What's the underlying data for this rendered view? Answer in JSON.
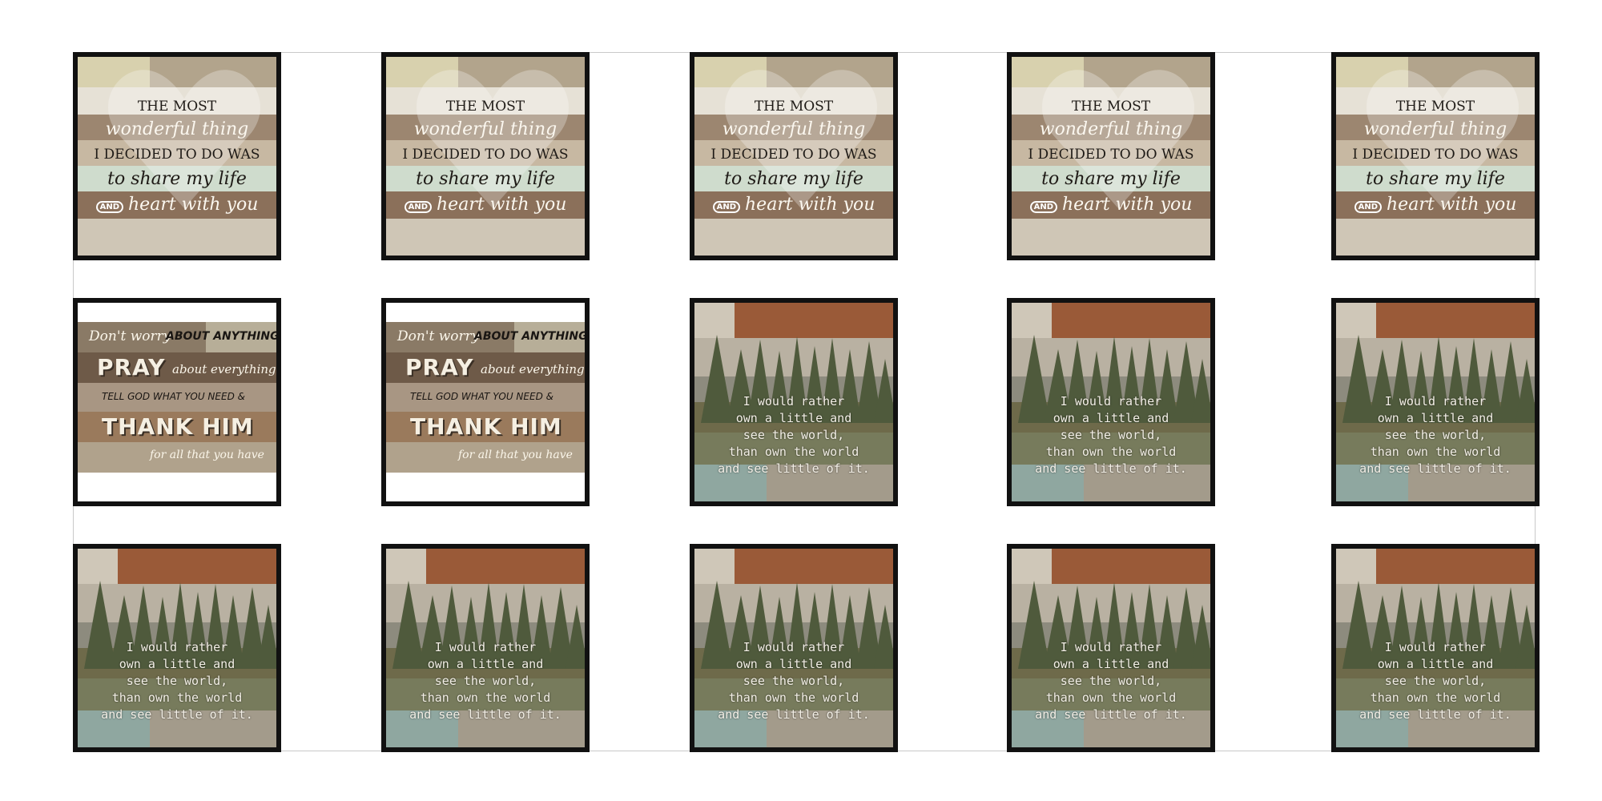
{
  "designs": {
    "heart": {
      "lines": [
        "THE MOST",
        "wonderful thing",
        "I DECIDED TO DO WAS",
        "to share my life",
        "heart with you"
      ],
      "and_word": "AND"
    },
    "pray": {
      "line1_script": "Don't worry",
      "line1_caps": "ABOUT ANYTHING",
      "line2_big": "PRAY",
      "line2_script": "about everything",
      "line3": "TELL GOD WHAT YOU NEED &",
      "line4_big": "THANK HIM",
      "line5": "for all that you have"
    },
    "world": {
      "lines": [
        "I would rather",
        "own a little and",
        "see the world,",
        "than own the world",
        "and see little of it."
      ]
    }
  },
  "grid": {
    "rows": [
      [
        "heart",
        "heart",
        "heart",
        "heart",
        "heart"
      ],
      [
        "pray",
        "pray",
        "world",
        "world",
        "world"
      ],
      [
        "world",
        "world",
        "world",
        "world",
        "world"
      ]
    ]
  },
  "colors": {
    "frame": "#111111",
    "tree_green": "#4f5a3c",
    "text_light": "#f3efe6"
  }
}
